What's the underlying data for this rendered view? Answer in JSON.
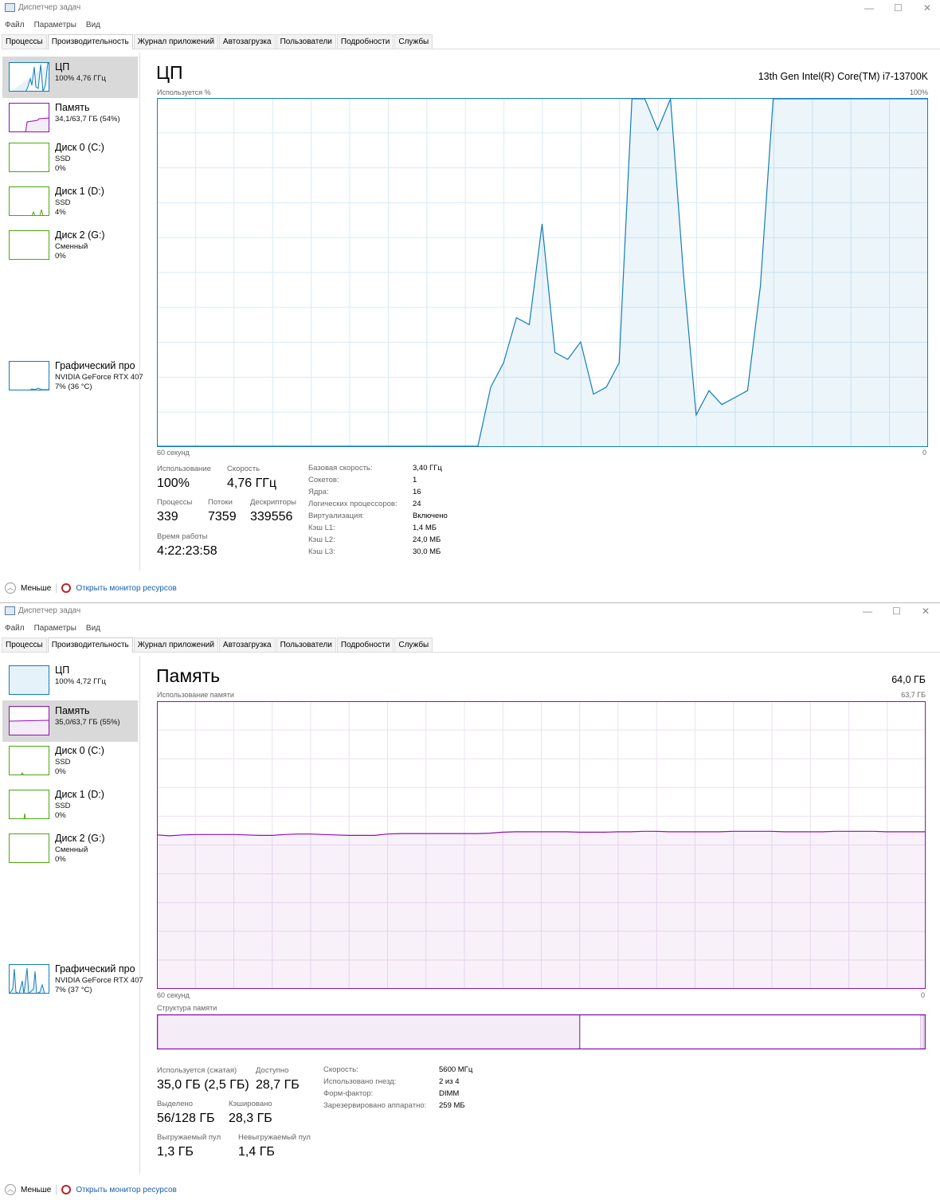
{
  "app_title": "Диспетчер задач",
  "menu": [
    "Файл",
    "Параметры",
    "Вид"
  ],
  "tabs": [
    "Процессы",
    "Производительность",
    "Журнал приложений",
    "Автозагрузка",
    "Пользователи",
    "Подробности",
    "Службы"
  ],
  "footer": {
    "less": "Меньше",
    "resmon": "Открыть монитор ресурсов"
  },
  "window1": {
    "sidebar": [
      {
        "name": "ЦП",
        "sub1": "100% 4,76 ГГц"
      },
      {
        "name": "Память",
        "sub1": "34,1/63,7 ГБ (54%)"
      },
      {
        "name": "Диск 0 (C:)",
        "sub1": "SSD",
        "sub2": "0%"
      },
      {
        "name": "Диск 1 (D:)",
        "sub1": "SSD",
        "sub2": "4%"
      },
      {
        "name": "Диск 2 (G:)",
        "sub1": "Сменный",
        "sub2": "0%"
      },
      {
        "name": "Графический про",
        "sub1": "NVIDIA GeForce RTX 407",
        "sub2": "7% (36 °C)"
      }
    ],
    "title": "ЦП",
    "model": "13th Gen Intel(R) Core(TM) i7-13700K",
    "graph_label": "Используется %",
    "graph_max": "100%",
    "time_label": "60 секунд",
    "time_end": "0",
    "stats": {
      "usage_l": "Использование",
      "usage": "100%",
      "speed_l": "Скорость",
      "speed": "4,76 ГГц",
      "proc_l": "Процессы",
      "proc": "339",
      "threads_l": "Потоки",
      "threads": "7359",
      "handles_l": "Дескрипторы",
      "handles": "339556",
      "uptime_l": "Время работы",
      "uptime": "4:22:23:58"
    },
    "details": [
      [
        "Базовая скорость:",
        "3,40 ГГц"
      ],
      [
        "Сокетов:",
        "1"
      ],
      [
        "Ядра:",
        "16"
      ],
      [
        "Логических процессоров:",
        "24"
      ],
      [
        "Виртуализация:",
        "Включено"
      ],
      [
        "Кэш L1:",
        "1,4 МБ"
      ],
      [
        "Кэш L2:",
        "24,0 МБ"
      ],
      [
        "Кэш L3:",
        "30,0 МБ"
      ]
    ]
  },
  "window2": {
    "sidebar": [
      {
        "name": "ЦП",
        "sub1": "100% 4,72 ГГц"
      },
      {
        "name": "Память",
        "sub1": "35,0/63,7 ГБ (55%)"
      },
      {
        "name": "Диск 0 (C:)",
        "sub1": "SSD",
        "sub2": "0%"
      },
      {
        "name": "Диск 1 (D:)",
        "sub1": "SSD",
        "sub2": "0%"
      },
      {
        "name": "Диск 2 (G:)",
        "sub1": "Сменный",
        "sub2": "0%"
      },
      {
        "name": "Графический про",
        "sub1": "NVIDIA GeForce RTX 407",
        "sub2": "7% (37 °C)"
      }
    ],
    "title": "Память",
    "total": "64,0 ГБ",
    "graph_label": "Использование памяти",
    "graph_max": "63,7 ГБ",
    "time_label": "60 секунд",
    "time_end": "0",
    "composition_label": "Структура памяти",
    "stats": {
      "used_l": "Используется (сжатая)",
      "used": "35,0 ГБ (2,5 ГБ)",
      "avail_l": "Доступно",
      "avail": "28,7 ГБ",
      "commit_l": "Выделено",
      "commit": "56/128 ГБ",
      "cached_l": "Кэшировано",
      "cached": "28,3 ГБ",
      "paged_l": "Выгружаемый пул",
      "paged": "1,3 ГБ",
      "nonpaged_l": "Невыгружаемый пул",
      "nonpaged": "1,4 ГБ"
    },
    "details": [
      [
        "Скорость:",
        "5600 МГц"
      ],
      [
        "Использовано гнезд:",
        "2 из 4"
      ],
      [
        "Форм-фактор:",
        "DIMM"
      ],
      [
        "Зарезервировано аппаратно:",
        "259 МБ"
      ]
    ]
  },
  "chart_data": [
    {
      "type": "area",
      "title": "ЦП",
      "ylabel": "Используется %",
      "xlabel": "60 секунд",
      "ylim": [
        0,
        100
      ],
      "color": "#117dbb",
      "values": [
        0,
        0,
        0,
        0,
        0,
        0,
        0,
        0,
        0,
        0,
        0,
        0,
        0,
        0,
        0,
        0,
        0,
        0,
        0,
        0,
        0,
        0,
        0,
        0,
        0,
        0,
        17,
        24,
        37,
        35,
        64,
        27,
        25,
        30,
        15,
        17,
        24,
        100,
        100,
        91,
        100,
        50,
        9,
        16,
        12,
        14,
        16,
        46,
        100,
        100,
        100,
        100,
        100,
        100,
        100,
        100,
        100,
        100,
        100,
        100,
        100
      ]
    },
    {
      "type": "area",
      "title": "Память",
      "ylabel": "Использование памяти",
      "xlabel": "60 секунд",
      "ylim": [
        0,
        63.7
      ],
      "color": "#8b12ae",
      "values": [
        34.1,
        33.9,
        34.1,
        34.2,
        34.2,
        34.2,
        34.2,
        34.1,
        34.0,
        34.0,
        34.2,
        34.3,
        34.3,
        34.2,
        34.1,
        34.0,
        34.0,
        34.0,
        34.3,
        34.4,
        34.4,
        34.4,
        34.4,
        34.4,
        34.4,
        34.4,
        34.5,
        34.7,
        34.8,
        34.8,
        34.8,
        34.8,
        34.8,
        34.7,
        34.7,
        34.7,
        34.8,
        34.8,
        34.9,
        34.9,
        34.8,
        34.8,
        34.8,
        34.8,
        34.8,
        34.9,
        34.9,
        34.9,
        34.9,
        34.8,
        34.8,
        34.8,
        34.8,
        34.9,
        34.9,
        34.9,
        34.9,
        34.8,
        34.8,
        34.8,
        34.8
      ],
      "composition": {
        "in_use_pct": 55,
        "modified_pct": 0.3,
        "standby_pct": 44.2
      }
    }
  ]
}
